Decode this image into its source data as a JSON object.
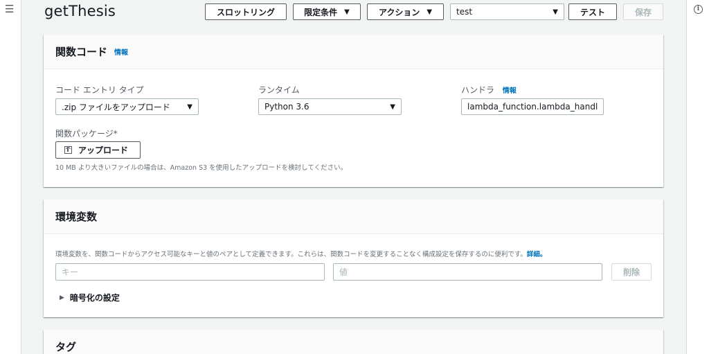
{
  "page_title": "getThesis",
  "toolbar": {
    "throttling_label": "スロットリング",
    "qualifier_label": "限定条件",
    "actions_label": "アクション",
    "test_event_value": "test",
    "test_label": "テスト",
    "save_label": "保存"
  },
  "function_code": {
    "title": "関数コード",
    "info": "情報",
    "code_entry_label": "コード エントリ タイプ",
    "code_entry_value": ".zip ファイルをアップロード",
    "runtime_label": "ランタイム",
    "runtime_value": "Python 3.6",
    "handler_label": "ハンドラ",
    "handler_info": "情報",
    "handler_value": "lambda_function.lambda_handler",
    "package_label": "関数パッケージ*",
    "upload_label": "アップロード",
    "upload_hint": "10 MB より大きいファイルの場合は、Amazon S3 を使用したアップロードを検討してください。"
  },
  "env_vars": {
    "title": "環境変数",
    "description": "環境変数を、関数コードからアクセス可能なキーと値のペアとして定義できます。これらは、関数コードを変更することなく構成設定を保存するのに便利です。",
    "detail_link": "詳細。",
    "key_placeholder": "キー",
    "value_placeholder": "値",
    "delete_label": "削除",
    "encryption_label": "暗号化の設定"
  },
  "tags": {
    "title": "タグ"
  },
  "icons": {
    "menu": "hamburger-menu-icon",
    "info": "info-circle-icon",
    "dropdown": "caret-down-icon",
    "upload": "upload-icon",
    "expand": "caret-right-icon"
  }
}
